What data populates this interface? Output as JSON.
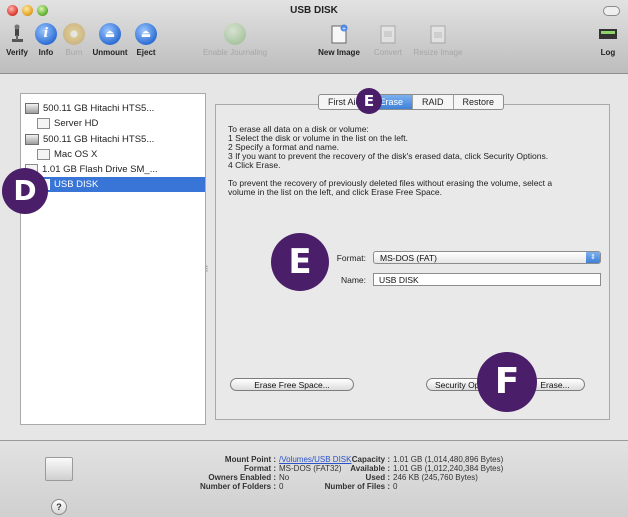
{
  "window": {
    "title": "USB DISK"
  },
  "toolbar": {
    "items": [
      {
        "label": "Verify",
        "icon": "microscope-icon",
        "enabled": true
      },
      {
        "label": "Info",
        "icon": "info-icon",
        "enabled": true
      },
      {
        "label": "Burn",
        "icon": "burn-icon",
        "enabled": false
      },
      {
        "label": "Unmount",
        "icon": "unmount-icon",
        "enabled": true
      },
      {
        "label": "Eject",
        "icon": "eject-icon",
        "enabled": true
      },
      {
        "label": "Enable Journaling",
        "icon": "journaling-icon",
        "enabled": false
      },
      {
        "label": "New Image",
        "icon": "new-image-icon",
        "enabled": true
      },
      {
        "label": "Convert",
        "icon": "convert-icon",
        "enabled": false
      },
      {
        "label": "Resize Image",
        "icon": "resize-image-icon",
        "enabled": false
      }
    ],
    "log_label": "Log"
  },
  "sidebar": {
    "items": [
      {
        "label": "500.11 GB Hitachi HTS5...",
        "kind": "disk"
      },
      {
        "label": "Server HD",
        "kind": "volume"
      },
      {
        "label": "500.11 GB Hitachi HTS5...",
        "kind": "disk"
      },
      {
        "label": "Mac OS X",
        "kind": "volume"
      },
      {
        "label": "1.01 GB Flash Drive SM_...",
        "kind": "disk"
      },
      {
        "label": "USB DISK",
        "kind": "volume",
        "selected": true
      }
    ]
  },
  "tabs": [
    {
      "label": "First Aid"
    },
    {
      "label": "Erase",
      "active": true
    },
    {
      "label": "RAID"
    },
    {
      "label": "Restore"
    }
  ],
  "erase": {
    "instructions": [
      "To erase all data on a disk or volume:",
      "1 Select the disk or volume in the list on the left.",
      "2 Specify a format and name.",
      "3 If you want to prevent the recovery of the disk's erased data, click Security Options.",
      "4 Click Erase."
    ],
    "note_line1": "To prevent the recovery of previously deleted files without erasing the volume, select a",
    "note_line2": "volume in the list on the left, and click Erase Free Space.",
    "format_label": "Format:",
    "format_value": "MS-DOS (FAT)",
    "name_label": "Name:",
    "name_value": "USB DISK",
    "erase_free_space_button": "Erase Free Space...",
    "security_options_button": "Security Options...",
    "erase_button": "Erase..."
  },
  "callouts": {
    "d": "D",
    "e_tab": "E",
    "e_form": "E",
    "f": "F"
  },
  "info": {
    "mount_point_label": "Mount Point :",
    "mount_point_value": "/Volumes/USB DISK",
    "format_label": "Format :",
    "format_value": "MS-DOS (FAT32)",
    "owners_label": "Owners Enabled :",
    "owners_value": "No",
    "folders_label": "Number of Folders :",
    "folders_value": "0",
    "capacity_label": "Capacity :",
    "capacity_value": "1.01 GB (1,014,480,896 Bytes)",
    "available_label": "Available :",
    "available_value": "1.01 GB (1,012,240,384 Bytes)",
    "used_label": "Used :",
    "used_value": "246 KB (245,760 Bytes)",
    "files_label": "Number of Files :",
    "files_value": "0"
  },
  "colors": {
    "accent": "#3875d7",
    "callout": "#4b1e6a"
  }
}
